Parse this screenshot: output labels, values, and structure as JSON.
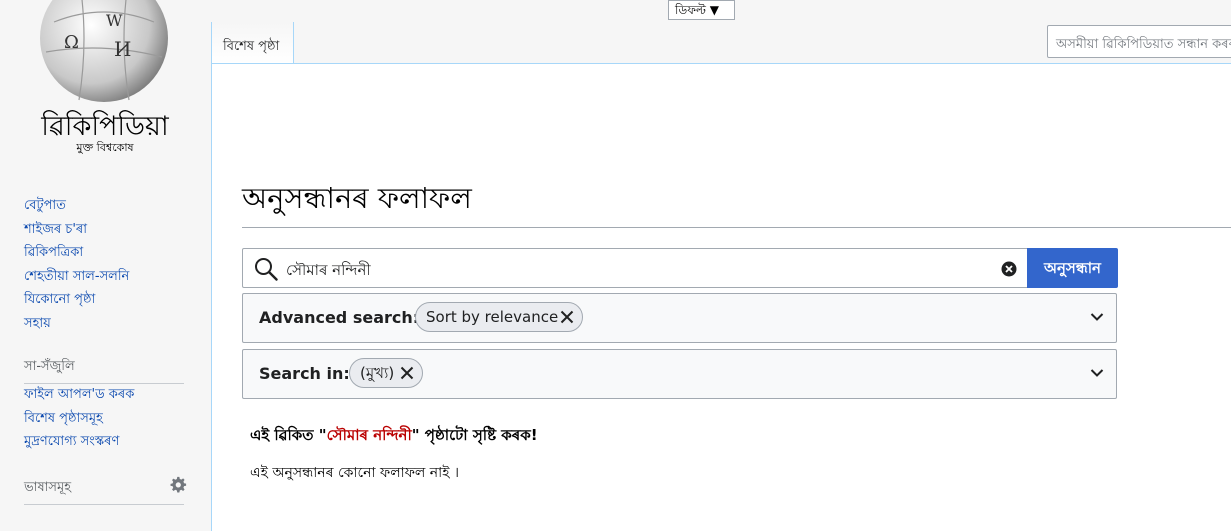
{
  "logo": {
    "wordmark": "ৱিকিপিডিয়া",
    "tagline": "মুক্ত বিশ্বকোষ",
    "globe_glyphs": [
      "Ω",
      "W",
      "И"
    ]
  },
  "sidebar": {
    "main_nav": [
      {
        "label": "বেটুপাত"
      },
      {
        "label": "শাইজৰ চ'ৰা"
      },
      {
        "label": "ৱিকিপত্ৰিকা"
      },
      {
        "label": "শেহতীয়া সাল-সলনি"
      },
      {
        "label": "যিকোনো পৃষ্ঠা"
      },
      {
        "label": "সহায়"
      }
    ],
    "tools_heading": "সা-সঁজুলি",
    "tools": [
      {
        "label": "ফাইল আপল'ড কৰক"
      },
      {
        "label": "বিশেষ পৃষ্ঠাসমূহ"
      },
      {
        "label": "মুদ্ৰণযোগ্য সংস্কৰণ"
      }
    ],
    "languages_heading": "ভাষাসমূহ",
    "languages_icon": "gear-icon"
  },
  "header": {
    "variant_label": "ডিফল্ট ▼",
    "tab_label": "বিশেষ পৃষ্ঠা",
    "search_placeholder": "অসমীয়া ৱিকিপিডিয়াত সন্ধান কৰক"
  },
  "main": {
    "title": "অনুসন্ধানৰ ফলাফল",
    "search_value": "সৌমাৰ নন্দিনী",
    "search_button": "অনুসন্ধান",
    "search_icon": "search-icon",
    "clear_icon": "clear-icon",
    "advanced_label": "Advanced search:",
    "sort_chip": "Sort by relevance",
    "search_in_label": "Search in:",
    "namespace_chip": "(মুখ্য)",
    "create_prefix": "এই ৱিকিত \"",
    "create_link": "সৌমাৰ নন্দিনী",
    "create_suffix": "\" পৃষ্ঠাটো সৃষ্টি কৰক!",
    "no_results": "এই অনুসন্ধানৰ কোনো ফলাফল নাই ।"
  },
  "colors": {
    "link": "#0645ad",
    "redlink": "#ba0000",
    "button": "#3366cc",
    "border": "#a2a9b1",
    "tab_border": "#a7d7f9"
  }
}
